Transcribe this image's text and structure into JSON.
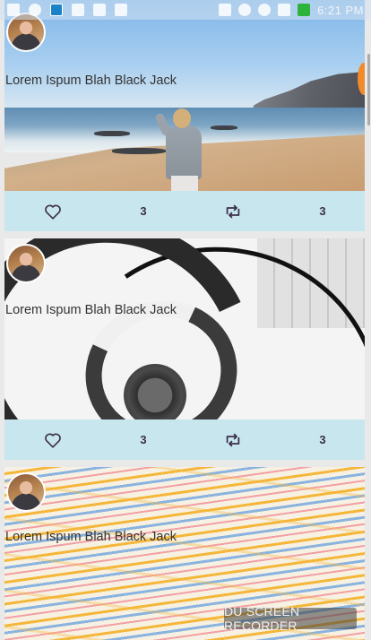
{
  "status_bar": {
    "time": "6:21 PM"
  },
  "posts": [
    {
      "caption": "Lorem Ispum Blah Black Jack",
      "likes": "3",
      "retweets": "3",
      "image": "beach-photo"
    },
    {
      "caption": "Lorem Ispum Blah Black Jack",
      "likes": "3",
      "retweets": "3",
      "image": "spiral-staircase-photo"
    },
    {
      "caption": "Lorem Ispum Blah Black Jack",
      "likes": "",
      "retweets": "",
      "image": "wave-pattern-photo"
    }
  ],
  "icons": {
    "like": "heart-icon",
    "retweet": "retweet-icon"
  },
  "colors": {
    "action_bar": "#c8e6ed",
    "icon": "#3a2f4a",
    "background": "#e9e9ea"
  },
  "watermark": "DU SCREEN RECORDER"
}
